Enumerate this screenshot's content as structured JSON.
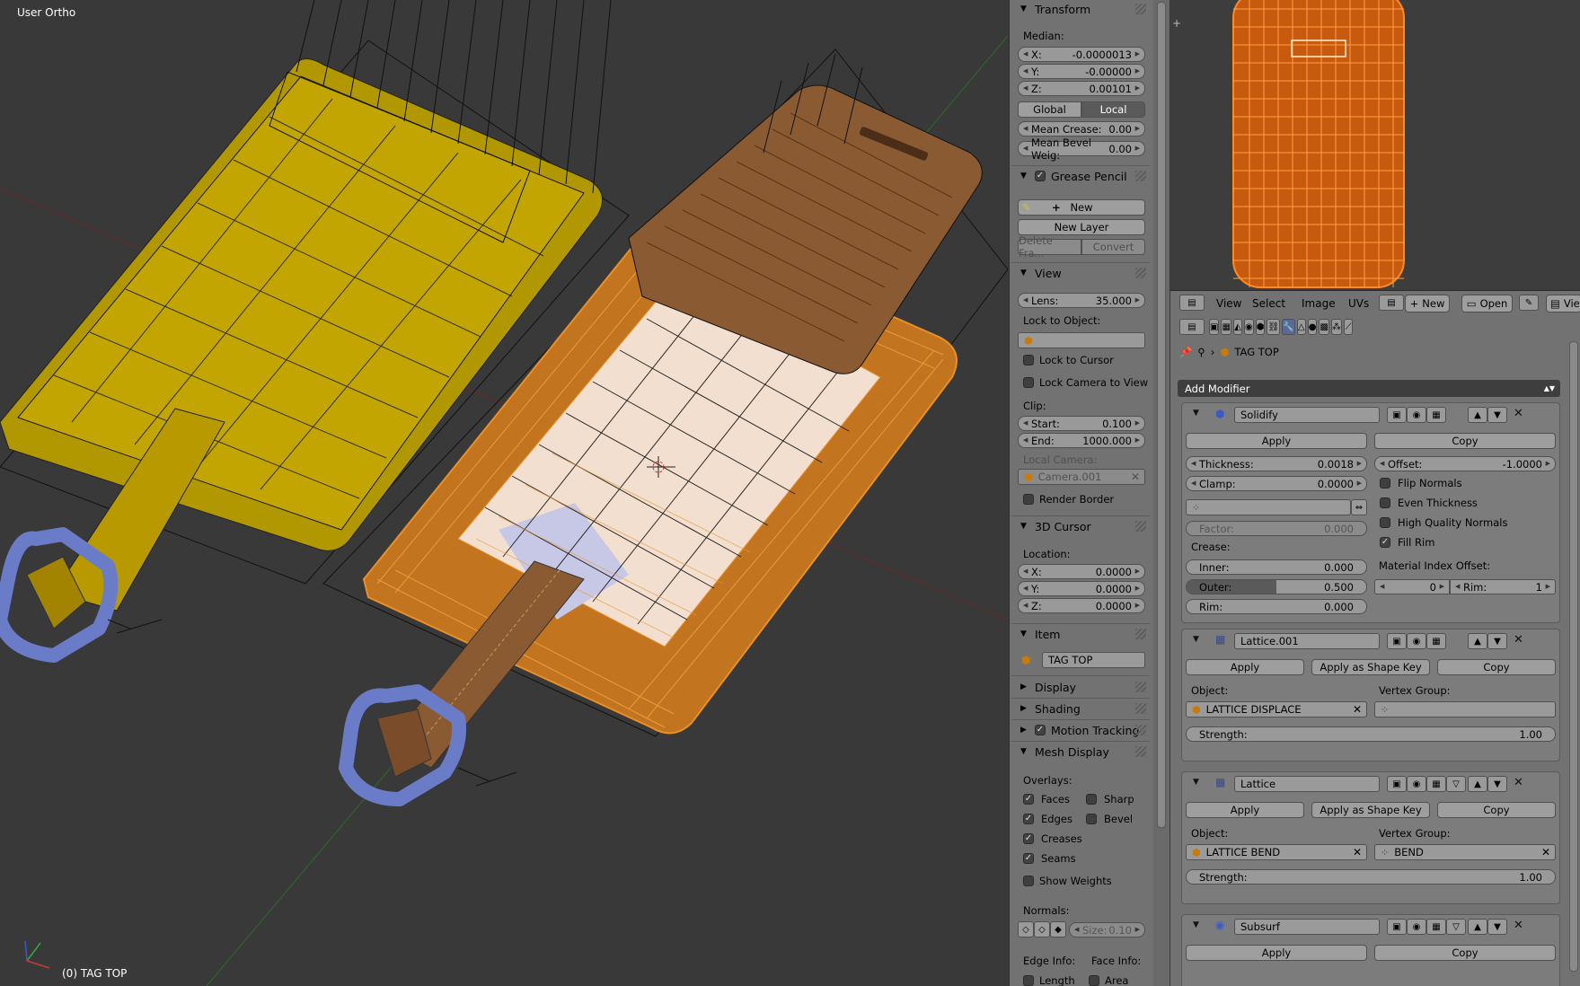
{
  "viewport": {
    "view_name": "User Ortho",
    "object_info": "(0) TAG TOP"
  },
  "npanel": {
    "transform": {
      "title": "Transform",
      "median_label": "Median:",
      "x_label": "X:",
      "x_value": "-0.0000013",
      "y_label": "Y:",
      "y_value": "-0.00000",
      "z_label": "Z:",
      "z_value": "0.00101",
      "global_label": "Global",
      "local_label": "Local",
      "mean_crease_label": "Mean Crease:",
      "mean_crease_value": "0.00",
      "mean_bevel_label": "Mean Bevel Weig:",
      "mean_bevel_value": "0.00"
    },
    "grease_pencil": {
      "title": "Grease Pencil",
      "new_label": "New",
      "new_layer_label": "New Layer",
      "delete_frame_label": "Delete Fra...",
      "convert_label": "Convert"
    },
    "view": {
      "title": "View",
      "lens_label": "Lens:",
      "lens_value": "35.000",
      "lock_to_object_label": "Lock to Object:",
      "lock_to_cursor_label": "Lock to Cursor",
      "lock_camera_label": "Lock Camera to View",
      "clip_label": "Clip:",
      "start_label": "Start:",
      "start_value": "0.100",
      "end_label": "End:",
      "end_value": "1000.000",
      "local_camera_label": "Local Camera:",
      "local_camera_value": "Camera.001",
      "render_border_label": "Render Border"
    },
    "cursor": {
      "title": "3D Cursor",
      "location_label": "Location:",
      "x_label": "X:",
      "x_value": "0.0000",
      "y_label": "Y:",
      "y_value": "0.0000",
      "z_label": "Z:",
      "z_value": "0.0000"
    },
    "item": {
      "title": "Item",
      "name": "TAG TOP"
    },
    "display": {
      "title": "Display"
    },
    "shading": {
      "title": "Shading"
    },
    "motion_tracking": {
      "title": "Motion Tracking"
    },
    "mesh_display": {
      "title": "Mesh Display",
      "overlays_label": "Overlays:",
      "faces_label": "Faces",
      "sharp_label": "Sharp",
      "edges_label": "Edges",
      "bevel_label": "Bevel",
      "creases_label": "Creases",
      "seams_label": "Seams",
      "show_weights_label": "Show Weights",
      "normals_label": "Normals:",
      "size_label": "Size:",
      "size_value": "0.10",
      "edge_info_label": "Edge Info:",
      "face_info_label": "Face Info:",
      "length_label": "Length",
      "area_label": "Area"
    }
  },
  "uv_header": {
    "view_label": "View",
    "select_label": "Select",
    "image_label": "Image",
    "uvs_label": "UVs",
    "new_label": "New",
    "open_label": "Open",
    "view2_label": "View"
  },
  "properties": {
    "breadcrumb_object": "TAG TOP",
    "add_modifier_label": "Add Modifier",
    "solidify": {
      "name": "Solidify",
      "apply_label": "Apply",
      "copy_label": "Copy",
      "thickness_label": "Thickness:",
      "thickness_value": "0.0018",
      "offset_label": "Offset:",
      "offset_value": "-1.0000",
      "clamp_label": "Clamp:",
      "clamp_value": "0.0000",
      "flip_normals_label": "Flip Normals",
      "even_thickness_label": "Even Thickness",
      "high_quality_label": "High Quality Normals",
      "fill_rim_label": "Fill Rim",
      "factor_label": "Factor:",
      "factor_value": "0.000",
      "crease_label": "Crease:",
      "inner_label": "Inner:",
      "inner_value": "0.000",
      "outer_label": "Outer:",
      "outer_value": "0.500",
      "outer_fraction": 0.5,
      "rim_label": "Rim:",
      "rim_value": "0.000",
      "material_index_label": "Material Index Offset:",
      "mat_value": "0",
      "mat_rim_label": "Rim:",
      "mat_rim_value": "1"
    },
    "lattice001": {
      "name": "Lattice.001",
      "apply_label": "Apply",
      "shape_key_label": "Apply as Shape Key",
      "copy_label": "Copy",
      "object_label": "Object:",
      "object_value": "LATTICE DISPLACE",
      "vgroup_label": "Vertex Group:",
      "vgroup_value": "",
      "strength_label": "Strength:",
      "strength_value": "1.00"
    },
    "lattice": {
      "name": "Lattice",
      "apply_label": "Apply",
      "shape_key_label": "Apply as Shape Key",
      "copy_label": "Copy",
      "object_label": "Object:",
      "object_value": "LATTICE BEND",
      "vgroup_label": "Vertex Group:",
      "vgroup_value": "BEND",
      "strength_label": "Strength:",
      "strength_value": "1.00"
    },
    "subsurf": {
      "name": "Subsurf",
      "apply_label": "Apply",
      "copy_label": "Copy"
    }
  },
  "colors": {
    "yellow_tag": "#c2a300",
    "selected_orange": "#e8902a",
    "leather_brown": "#8a5a32",
    "buckle_blue": "#6a7cc8",
    "panel_gray": "#727272"
  }
}
